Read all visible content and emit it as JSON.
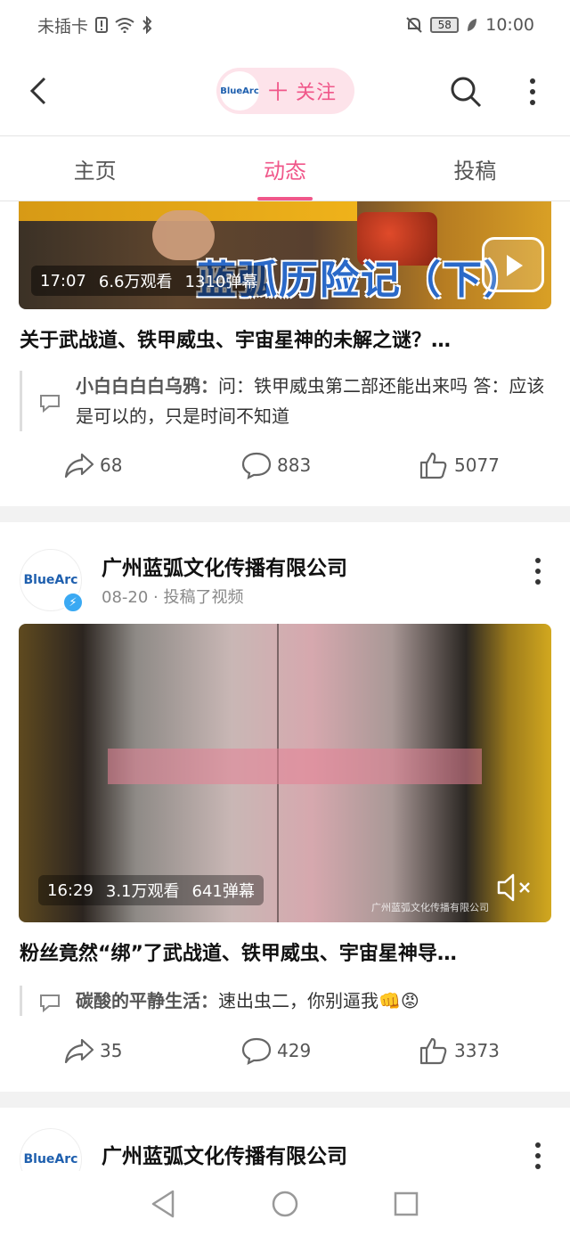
{
  "status_bar": {
    "carrier": "未插卡",
    "battery": "58",
    "time": "10:00"
  },
  "header": {
    "pill_logo": "BlueArc",
    "follow_label": "十 关注"
  },
  "tabs": [
    {
      "label": "主页"
    },
    {
      "label": "动态"
    },
    {
      "label": "投稿"
    }
  ],
  "posts": [
    {
      "thumb_overlay": "蓝弧历险记（下）",
      "duration": "17:07",
      "views": "6.6万观看",
      "danmaku": "1310弹幕",
      "title": "关于武战道、铁甲威虫、宇宙星神的未解之谜？…",
      "comment_user": "小白白白白乌鸦：",
      "comment_text": "问：铁甲威虫第二部还能出来吗 答：应该是可以的，只是时间不知道",
      "shares": "68",
      "comments": "883",
      "likes": "5077"
    },
    {
      "author": "广州蓝弧文化传播有限公司",
      "avatar_text": "BlueArc",
      "meta": "08-20 · 投稿了视频",
      "duration": "16:29",
      "views": "3.1万观看",
      "danmaku": "641弹幕",
      "watermark": "广州蓝弧文化传播有限公司",
      "title": "粉丝竟然“绑”了武战道、铁甲威虫、宇宙星神导…",
      "comment_user": "碳酸的平静生活：",
      "comment_text": "速出虫二，你别逼我👊😡",
      "shares": "35",
      "comments": "429",
      "likes": "3373"
    },
    {
      "author": "广州蓝弧文化传播有限公司",
      "avatar_text": "BlueArc"
    }
  ]
}
